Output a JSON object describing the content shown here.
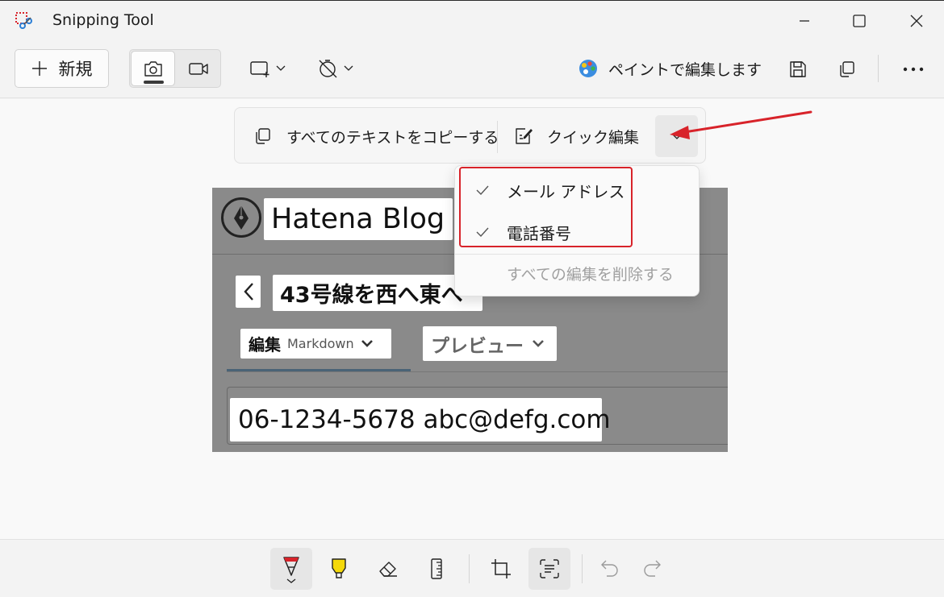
{
  "window": {
    "title": "Snipping Tool"
  },
  "toolbar": {
    "new_label": "新規",
    "paint_label": "ペイントで編集します"
  },
  "text_actions": {
    "copy_all_label": "すべてのテキストをコピーする",
    "quick_edit_label": "クイック編集"
  },
  "quick_edit_menu": {
    "items": [
      {
        "label": "メール アドレス",
        "checked": true
      },
      {
        "label": "電話番号",
        "checked": true
      }
    ],
    "delete_all_label": "すべての編集を削除する"
  },
  "screenshot": {
    "blog_name": "Hatena Blog",
    "post_title": "43号線を西へ東へ",
    "tab_edit": "編集",
    "tab_edit_format": "Markdown",
    "tab_preview": "プレビュー",
    "body_text": "06-1234-5678  abc@defg.com"
  },
  "colors": {
    "annotation_red": "#d8232a",
    "screenshot_bg": "#8a8a8a",
    "pen_red": "#d8232a",
    "highlighter_yellow": "#f5d90a"
  },
  "icons": {
    "app": "snipping-tool-icon",
    "paint": "paint-palette-icon"
  }
}
